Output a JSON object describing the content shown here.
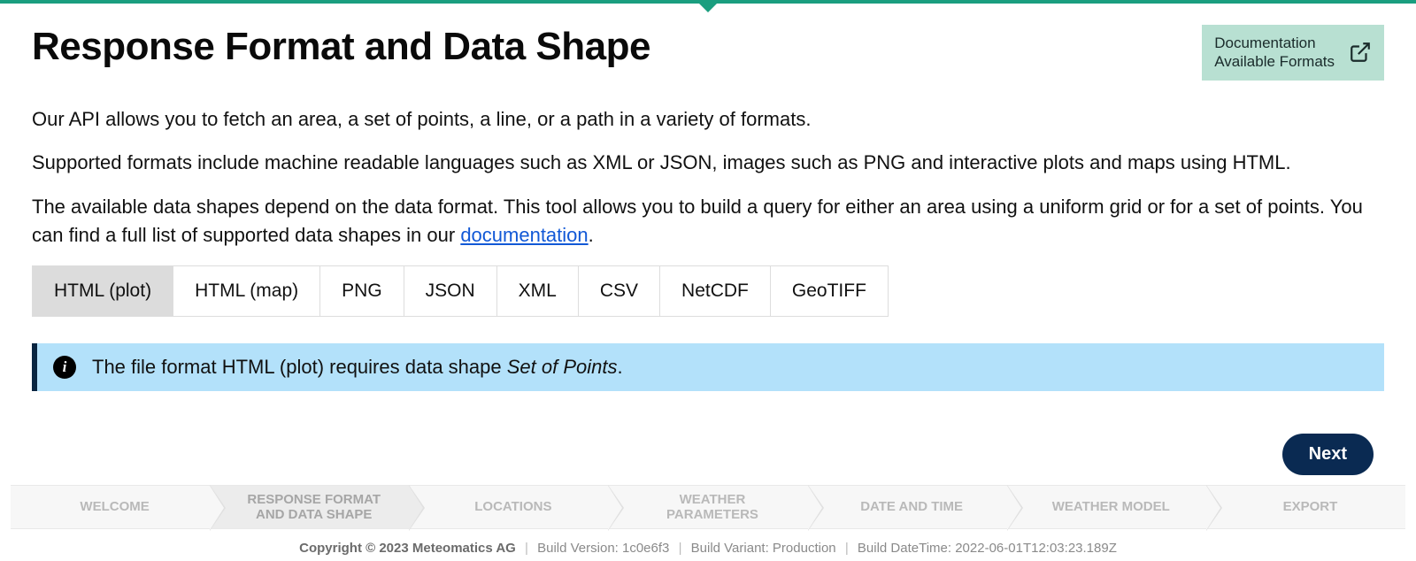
{
  "header": {
    "title": "Response Format and Data Shape",
    "docbox_line1": "Documentation",
    "docbox_line2": "Available Formats"
  },
  "intro": {
    "p1": "Our API allows you to fetch an area, a set of points, a line, or a path in a variety of formats.",
    "p2": "Supported formats include machine readable languages such as XML or JSON, images such as PNG and interactive plots and maps using HTML.",
    "p3_a": "The available data shapes depend on the data format. This tool allows you to build a query for either an area using a uniform grid or for a set of points. You can find a full list of supported data shapes in our ",
    "p3_link": "documentation",
    "p3_b": "."
  },
  "tabs": [
    {
      "label": "HTML (plot)",
      "active": true
    },
    {
      "label": "HTML (map)",
      "active": false
    },
    {
      "label": "PNG",
      "active": false
    },
    {
      "label": "JSON",
      "active": false
    },
    {
      "label": "XML",
      "active": false
    },
    {
      "label": "CSV",
      "active": false
    },
    {
      "label": "NetCDF",
      "active": false
    },
    {
      "label": "GeoTIFF",
      "active": false
    }
  ],
  "info": {
    "text_a": "The file format HTML (plot) requires data shape ",
    "em": "Set of Points",
    "text_b": "."
  },
  "buttons": {
    "next": "Next"
  },
  "stepper": [
    {
      "label": "WELCOME",
      "active": false
    },
    {
      "label": "RESPONSE FORMAT AND DATA SHAPE",
      "active": true
    },
    {
      "label": "LOCATIONS",
      "active": false
    },
    {
      "label": "WEATHER PARAMETERS",
      "active": false
    },
    {
      "label": "DATE AND TIME",
      "active": false
    },
    {
      "label": "WEATHER MODEL",
      "active": false
    },
    {
      "label": "EXPORT",
      "active": false
    }
  ],
  "footer": {
    "copyright": "Copyright © 2023 Meteomatics AG",
    "build_version_label": "Build Version: ",
    "build_version": "1c0e6f3",
    "build_variant_label": "Build Variant: ",
    "build_variant": "Production",
    "build_datetime_label": "Build DateTime: ",
    "build_datetime": "2022-06-01T12:03:23.189Z"
  }
}
